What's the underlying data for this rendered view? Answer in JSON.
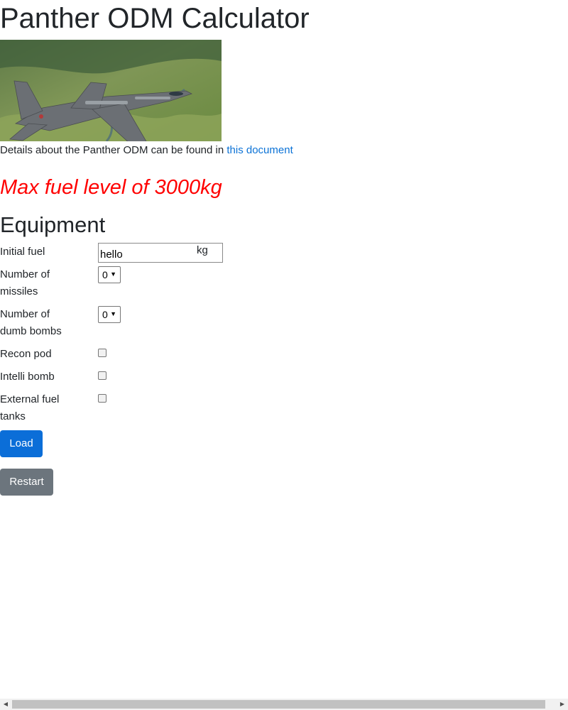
{
  "page": {
    "title": "Panther ODM Calculator",
    "hero_image": "Jaguar jet aircraft flying over green landscape"
  },
  "details": {
    "text": "Details about the Panther ODM can be found in ",
    "link_text": "this document"
  },
  "max_fuel": "Max fuel level of 3000kg",
  "equipment": {
    "title": "Equipment",
    "initial_fuel": {
      "label": "Initial fuel",
      "value": "hello",
      "unit": "kg"
    },
    "missiles": {
      "label": "Number of missiles",
      "value": "0"
    },
    "dumb_bombs": {
      "label": "Number of dumb bombs",
      "value": "0"
    },
    "recon_pod": {
      "label": "Recon pod",
      "checked": false
    },
    "intelli_bomb": {
      "label": "Intelli bomb",
      "checked": false
    },
    "external_fuel_tanks": {
      "label": "External fuel tanks",
      "checked": false
    }
  },
  "buttons": {
    "load": "Load",
    "restart": "Restart"
  },
  "colors": {
    "primary": "#0b6ed8",
    "secondary": "#6c757d",
    "danger": "#ff0000",
    "link": "#0b72d6"
  },
  "icons": {
    "dropdown": "caret-down-icon",
    "scroll_left": "arrow-left-icon",
    "scroll_right": "arrow-right-icon"
  }
}
